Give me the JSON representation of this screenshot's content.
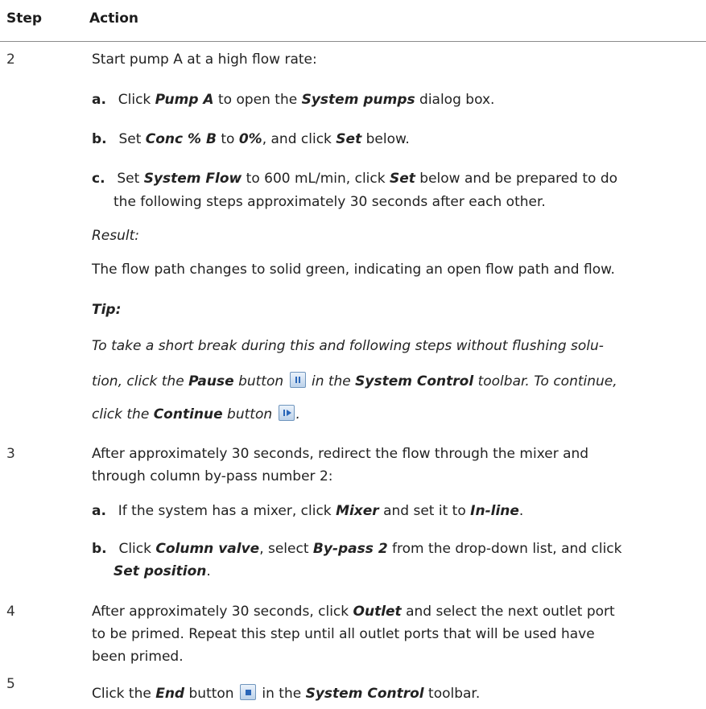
{
  "header": {
    "step": "Step",
    "action": "Action"
  },
  "rows": {
    "s2": {
      "num": "2",
      "intro": "Start pump A at a high flow rate:",
      "a": {
        "lbl": "a.",
        "p1": "Click ",
        "t1": "Pump A",
        "p2": " to open the ",
        "t2": "System pumps",
        "p3": " dialog box."
      },
      "b": {
        "lbl": "b.",
        "p1": "Set ",
        "t1": "Conc % B",
        "p2": " to ",
        "t2": "0%",
        "p3": ", and click ",
        "t3": "Set",
        "p4": " below."
      },
      "c": {
        "lbl": "c.",
        "p1": "Set ",
        "t1": "System Flow",
        "p2": " to 600 mL/min, click ",
        "t2": "Set",
        "p3": " below and be prepared to do",
        "line2": "the following steps approximately 30 seconds after each other."
      },
      "result_label": "Result:",
      "result_text": "The flow path changes to solid green, indicating an open flow path and flow.",
      "tip_label": "Tip:",
      "tip": {
        "l1": "To take a short break during this and following steps without flushing solu-",
        "l2_p1": "tion, click the ",
        "l2_t1": "Pause",
        "l2_p2": " button ",
        "l2_p3": " in the ",
        "l2_t2": "System Control",
        "l2_p4": " toolbar. To continue,",
        "l3_p1": "click the ",
        "l3_t1": "Continue",
        "l3_p2": " button ",
        "l3_p3": "."
      }
    },
    "s3": {
      "num": "3",
      "l1": "After approximately 30 seconds, redirect the flow through the mixer and",
      "l2": "through column by-pass number 2:",
      "a": {
        "lbl": "a.",
        "p1": "If the system has a mixer, click ",
        "t1": "Mixer",
        "p2": " and set it to ",
        "t2": "In-line",
        "p3": "."
      },
      "b": {
        "lbl": "b.",
        "p1": "Click ",
        "t1": "Column valve",
        "p2": ", select ",
        "t2": "By-pass 2",
        "p3": " from the drop-down list, and click",
        "t3": "Set position",
        "p4": "."
      }
    },
    "s4": {
      "num": "4",
      "l1_p1": "After approximately 30 seconds, click ",
      "l1_t1": "Outlet",
      "l1_p2": " and select the next outlet port",
      "l2": "to be primed. Repeat this step until all outlet ports that will be used have",
      "l3": "been primed."
    },
    "s5": {
      "num": "5",
      "p1": "Click the ",
      "t1": "End",
      "p2": " button ",
      "p3": " in the ",
      "t2": "System Control",
      "p4": " toolbar."
    }
  },
  "icons": {
    "pause": "pause-icon",
    "continue": "continue-icon",
    "end": "end-icon"
  }
}
